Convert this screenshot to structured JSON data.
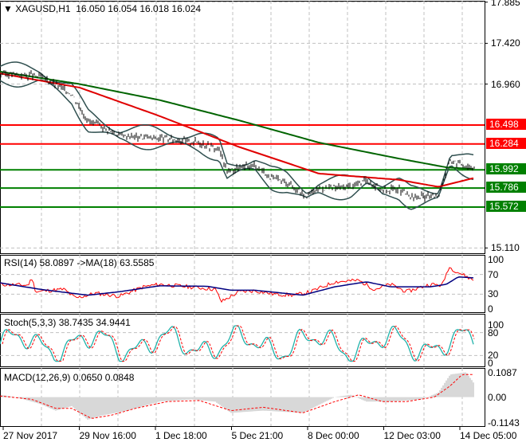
{
  "chart_data": {
    "type": "line",
    "title": "XAGUSD,H1",
    "ohlc": {
      "open": "16.050",
      "high": "16.054",
      "low": "16.018",
      "close": "16.024"
    },
    "price_ticks": [
      "17.885",
      "17.420",
      "16.960",
      "15.110"
    ],
    "price_ylim": [
      15.05,
      17.9
    ],
    "levels": [
      {
        "value": 16.498,
        "label": "16.498",
        "color": "#ff0000"
      },
      {
        "value": 16.284,
        "label": "16.284",
        "color": "#ff0000"
      },
      {
        "value": 15.992,
        "label": "15.992",
        "color": "#008000"
      },
      {
        "value": 15.786,
        "label": "15.786",
        "color": "#008000"
      },
      {
        "value": 15.572,
        "label": "15.572",
        "color": "#008000"
      }
    ],
    "x_labels": [
      "27 Nov 2017",
      "29 Nov 16:00",
      "1 Dec 18:00",
      "5 Dec 21:00",
      "8 Dec 00:00",
      "12 Dec 03:00",
      "14 Dec 05:00"
    ],
    "price_keypoints": [
      [
        0,
        17.08
      ],
      [
        50,
        17.05
      ],
      [
        90,
        16.85
      ],
      [
        110,
        16.55
      ],
      [
        150,
        16.38
      ],
      [
        200,
        16.35
      ],
      [
        250,
        16.3
      ],
      [
        275,
        16.22
      ],
      [
        285,
        15.98
      ],
      [
        320,
        16.05
      ],
      [
        340,
        15.9
      ],
      [
        360,
        15.85
      ],
      [
        385,
        15.7
      ],
      [
        400,
        15.78
      ],
      [
        440,
        15.8
      ],
      [
        460,
        15.88
      ],
      [
        480,
        15.76
      ],
      [
        500,
        15.78
      ],
      [
        515,
        15.68
      ],
      [
        550,
        15.7
      ],
      [
        565,
        16.1
      ],
      [
        580,
        16.05
      ],
      [
        595,
        16.02
      ]
    ],
    "ma_red_keypoints": [
      [
        0,
        17.08
      ],
      [
        100,
        16.92
      ],
      [
        200,
        16.6
      ],
      [
        300,
        16.25
      ],
      [
        400,
        15.95
      ],
      [
        500,
        15.88
      ],
      [
        550,
        15.8
      ],
      [
        595,
        15.9
      ]
    ],
    "ma_green_keypoints": [
      [
        0,
        17.1
      ],
      [
        100,
        16.96
      ],
      [
        200,
        16.78
      ],
      [
        300,
        16.55
      ],
      [
        400,
        16.3
      ],
      [
        500,
        16.12
      ],
      [
        560,
        16.02
      ],
      [
        595,
        16.0
      ]
    ],
    "rsi": {
      "label": "RSI(14) 58.0897  ->MA(18) 63.5585",
      "ticks": [
        "100",
        "70",
        "30",
        "0"
      ],
      "ylim": [
        0,
        100
      ],
      "keypoints": [
        [
          0,
          50
        ],
        [
          35,
          48
        ],
        [
          40,
          62
        ],
        [
          45,
          35
        ],
        [
          80,
          40
        ],
        [
          95,
          22
        ],
        [
          120,
          32
        ],
        [
          150,
          26
        ],
        [
          180,
          45
        ],
        [
          200,
          50
        ],
        [
          230,
          46
        ],
        [
          270,
          40
        ],
        [
          278,
          15
        ],
        [
          300,
          35
        ],
        [
          320,
          37
        ],
        [
          345,
          30
        ],
        [
          370,
          28
        ],
        [
          390,
          35
        ],
        [
          420,
          55
        ],
        [
          450,
          58
        ],
        [
          470,
          40
        ],
        [
          490,
          50
        ],
        [
          510,
          35
        ],
        [
          540,
          50
        ],
        [
          555,
          48
        ],
        [
          563,
          85
        ],
        [
          580,
          70
        ],
        [
          595,
          58
        ]
      ],
      "ma_keypoints": [
        [
          0,
          53
        ],
        [
          50,
          40
        ],
        [
          110,
          28
        ],
        [
          150,
          35
        ],
        [
          200,
          47
        ],
        [
          260,
          46
        ],
        [
          290,
          38
        ],
        [
          320,
          38
        ],
        [
          380,
          28
        ],
        [
          420,
          45
        ],
        [
          460,
          55
        ],
        [
          490,
          45
        ],
        [
          540,
          45
        ],
        [
          560,
          50
        ],
        [
          575,
          65
        ],
        [
          595,
          63
        ]
      ]
    },
    "stoch": {
      "label": "Stoch(5,3,3) 38.7435 34.9441",
      "ticks": [
        "100",
        "80",
        "20",
        "0"
      ],
      "ylim": [
        0,
        100
      ]
    },
    "macd": {
      "label": "MACD(12,26,9) 0.0650 0.0848",
      "ticks": [
        "0.1087",
        "0.00",
        "-0.1143"
      ],
      "ylim": [
        -0.125,
        0.115
      ],
      "hist_keypoints": [
        [
          0,
          0.01
        ],
        [
          20,
          0
        ],
        [
          50,
          -0.03
        ],
        [
          70,
          -0.06
        ],
        [
          90,
          -0.04
        ],
        [
          110,
          -0.1
        ],
        [
          130,
          -0.08
        ],
        [
          160,
          -0.06
        ],
        [
          200,
          -0.02
        ],
        [
          240,
          -0.01
        ],
        [
          270,
          -0.02
        ],
        [
          290,
          -0.07
        ],
        [
          330,
          -0.06
        ],
        [
          380,
          -0.07
        ],
        [
          420,
          0
        ],
        [
          440,
          0.01
        ],
        [
          460,
          -0.02
        ],
        [
          490,
          -0.02
        ],
        [
          530,
          -0.01
        ],
        [
          550,
          0.02
        ],
        [
          565,
          0.1
        ],
        [
          585,
          0.11
        ],
        [
          595,
          0.06
        ]
      ],
      "signal_keypoints": [
        [
          0,
          0.005
        ],
        [
          40,
          -0.01
        ],
        [
          70,
          -0.05
        ],
        [
          90,
          -0.05
        ],
        [
          115,
          -0.095
        ],
        [
          140,
          -0.08
        ],
        [
          170,
          -0.05
        ],
        [
          210,
          -0.02
        ],
        [
          250,
          -0.015
        ],
        [
          290,
          -0.06
        ],
        [
          330,
          -0.045
        ],
        [
          380,
          -0.07
        ],
        [
          420,
          -0.02
        ],
        [
          450,
          0.01
        ],
        [
          480,
          -0.02
        ],
        [
          510,
          -0.02
        ],
        [
          545,
          0
        ],
        [
          565,
          0.05
        ],
        [
          580,
          0.1
        ],
        [
          595,
          0.1
        ]
      ]
    }
  }
}
